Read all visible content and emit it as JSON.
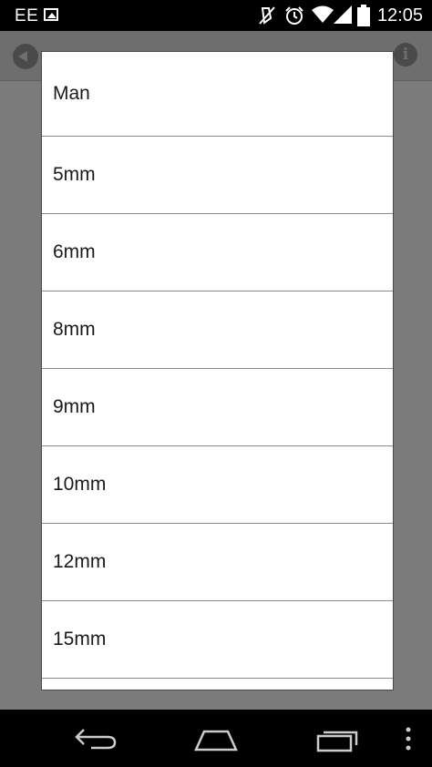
{
  "status_bar": {
    "carrier": "EE",
    "time": "12:05",
    "icons": [
      "image-icon",
      "mute-icon",
      "alarm-icon",
      "wifi-icon",
      "signal-icon",
      "battery-icon"
    ]
  },
  "app_header": {
    "icons": [
      "back-icon",
      "info-icon"
    ]
  },
  "dialog": {
    "options": [
      "Man",
      "5mm",
      "6mm",
      "8mm",
      "9mm",
      "10mm",
      "12mm",
      "15mm"
    ]
  },
  "nav_bar": {
    "icons": [
      "back-nav-icon",
      "home-nav-icon",
      "recent-apps-icon",
      "overflow-menu-icon"
    ]
  },
  "colors": {
    "scrim": "#7b7b7b",
    "dialog_bg": "#ffffff",
    "divider": "#8a8a8a",
    "bars": "#000000"
  }
}
